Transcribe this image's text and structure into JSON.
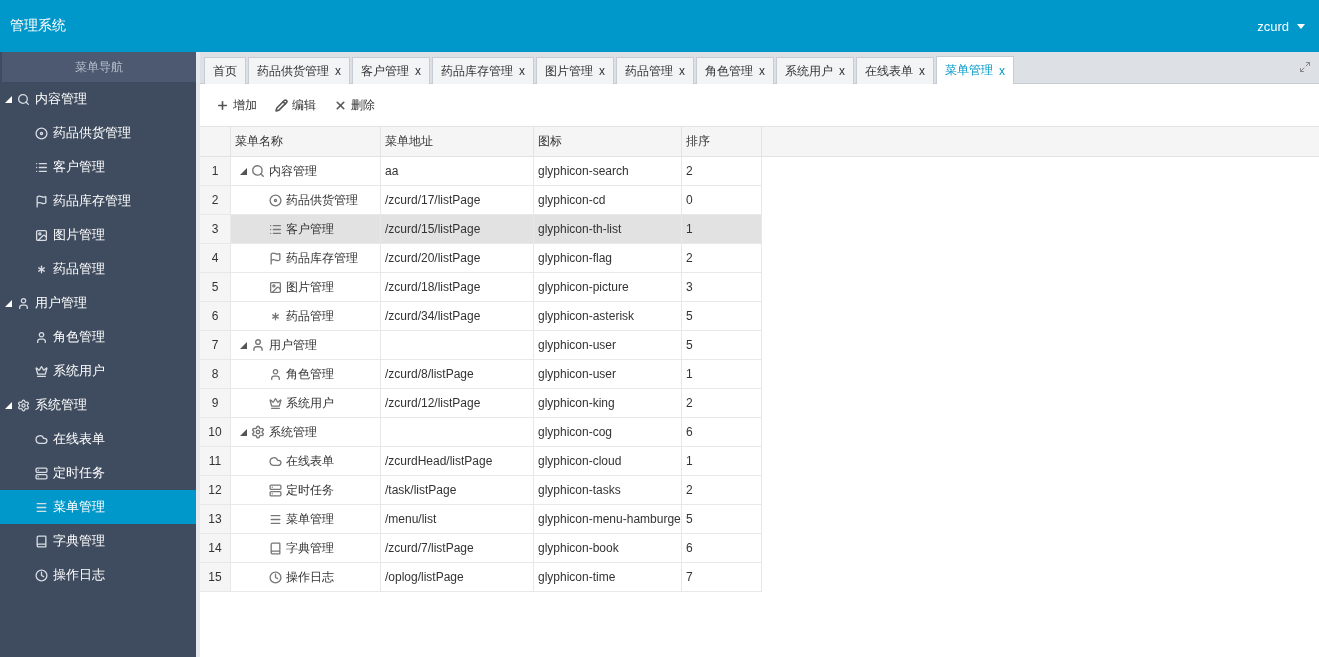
{
  "header": {
    "title": "管理系统",
    "user": "zcurd"
  },
  "sidebar": {
    "title": "菜单导航",
    "items": [
      {
        "label": "内容管理",
        "expanded": true,
        "selected": false,
        "children": [
          {
            "label": "药品供货管理",
            "selected": false
          },
          {
            "label": "客户管理",
            "selected": false
          },
          {
            "label": "药品库存管理",
            "selected": false
          },
          {
            "label": "图片管理",
            "selected": false
          },
          {
            "label": "药品管理",
            "selected": false
          }
        ]
      },
      {
        "label": "用户管理",
        "expanded": true,
        "selected": false,
        "children": [
          {
            "label": "角色管理",
            "selected": false
          },
          {
            "label": "系统用户",
            "selected": false
          }
        ]
      },
      {
        "label": "系统管理",
        "expanded": true,
        "selected": false,
        "children": [
          {
            "label": "在线表单",
            "selected": false
          },
          {
            "label": "定时任务",
            "selected": false
          },
          {
            "label": "菜单管理",
            "selected": true
          },
          {
            "label": "字典管理",
            "selected": false
          },
          {
            "label": "操作日志",
            "selected": false
          }
        ]
      }
    ]
  },
  "tabs": [
    {
      "label": "首页",
      "selected": false
    },
    {
      "label": "药品供货管理",
      "close": "x",
      "selected": false
    },
    {
      "label": "客户管理",
      "close": "x",
      "selected": false
    },
    {
      "label": "药品库存管理",
      "close": "x",
      "selected": false
    },
    {
      "label": "图片管理",
      "close": "x",
      "selected": false
    },
    {
      "label": "药品管理",
      "close": "x",
      "selected": false
    },
    {
      "label": "角色管理",
      "close": "x",
      "selected": false
    },
    {
      "label": "系统用户",
      "close": "x",
      "selected": false
    },
    {
      "label": "在线表单",
      "close": "x",
      "selected": false
    },
    {
      "label": "菜单管理",
      "close": "x",
      "selected": true
    }
  ],
  "toolbar": [
    {
      "label": "增加",
      "kind": "add"
    },
    {
      "label": "编辑",
      "kind": "edit"
    },
    {
      "label": "删除",
      "kind": "delete"
    }
  ],
  "table": {
    "columns": [
      "菜单名称",
      "菜单地址",
      "图标",
      "排序"
    ],
    "rows": [
      {
        "number": "1",
        "name": "内容管理",
        "url": "aa",
        "icon_name": "glyphicon-search",
        "order": "2",
        "expanded": true,
        "selected": false,
        "children": [
          {
            "number": "2",
            "name": "药品供货管理",
            "url": "/zcurd/17/listPage",
            "icon_name": "glyphicon-cd",
            "order": "0",
            "selected": false
          },
          {
            "number": "3",
            "name": "客户管理",
            "url": "/zcurd/15/listPage",
            "icon_name": "glyphicon-th-list",
            "order": "1",
            "selected": true
          },
          {
            "number": "4",
            "name": "药品库存管理",
            "url": "/zcurd/20/listPage",
            "icon_name": "glyphicon-flag",
            "order": "2",
            "selected": false
          },
          {
            "number": "5",
            "name": "图片管理",
            "url": "/zcurd/18/listPage",
            "icon_name": "glyphicon-picture",
            "order": "3",
            "selected": false
          },
          {
            "number": "6",
            "name": "药品管理",
            "url": "/zcurd/34/listPage",
            "icon_name": "glyphicon-asterisk",
            "order": "5",
            "selected": false
          }
        ]
      },
      {
        "number": "7",
        "name": "用户管理",
        "icon_name": "glyphicon-user",
        "order": "5",
        "expanded": true,
        "selected": false,
        "children": [
          {
            "number": "8",
            "name": "角色管理",
            "url": "/zcurd/8/listPage",
            "icon_name": "glyphicon-user",
            "order": "1",
            "selected": false
          },
          {
            "number": "9",
            "name": "系统用户",
            "url": "/zcurd/12/listPage",
            "icon_name": "glyphicon-king",
            "order": "2",
            "selected": false
          }
        ]
      },
      {
        "number": "10",
        "name": "系统管理",
        "icon_name": "glyphicon-cog",
        "order": "6",
        "expanded": true,
        "selected": false,
        "children": [
          {
            "number": "11",
            "name": "在线表单",
            "url": "/zcurdHead/listPage",
            "icon_name": "glyphicon-cloud",
            "order": "1",
            "selected": false
          },
          {
            "number": "12",
            "name": "定时任务",
            "url": "/task/listPage",
            "icon_name": "glyphicon-tasks",
            "order": "2",
            "selected": false
          },
          {
            "number": "13",
            "name": "菜单管理",
            "url": "/menu/list",
            "icon_name": "glyphicon-menu-hamburge",
            "order": "5",
            "selected": false
          },
          {
            "number": "14",
            "name": "字典管理",
            "url": "/zcurd/7/listPage",
            "icon_name": "glyphicon-book",
            "order": "6",
            "selected": false
          },
          {
            "number": "15",
            "name": "操作日志",
            "url": "/oplog/listPage",
            "icon_name": "glyphicon-time",
            "order": "7",
            "selected": false
          }
        ]
      }
    ]
  }
}
